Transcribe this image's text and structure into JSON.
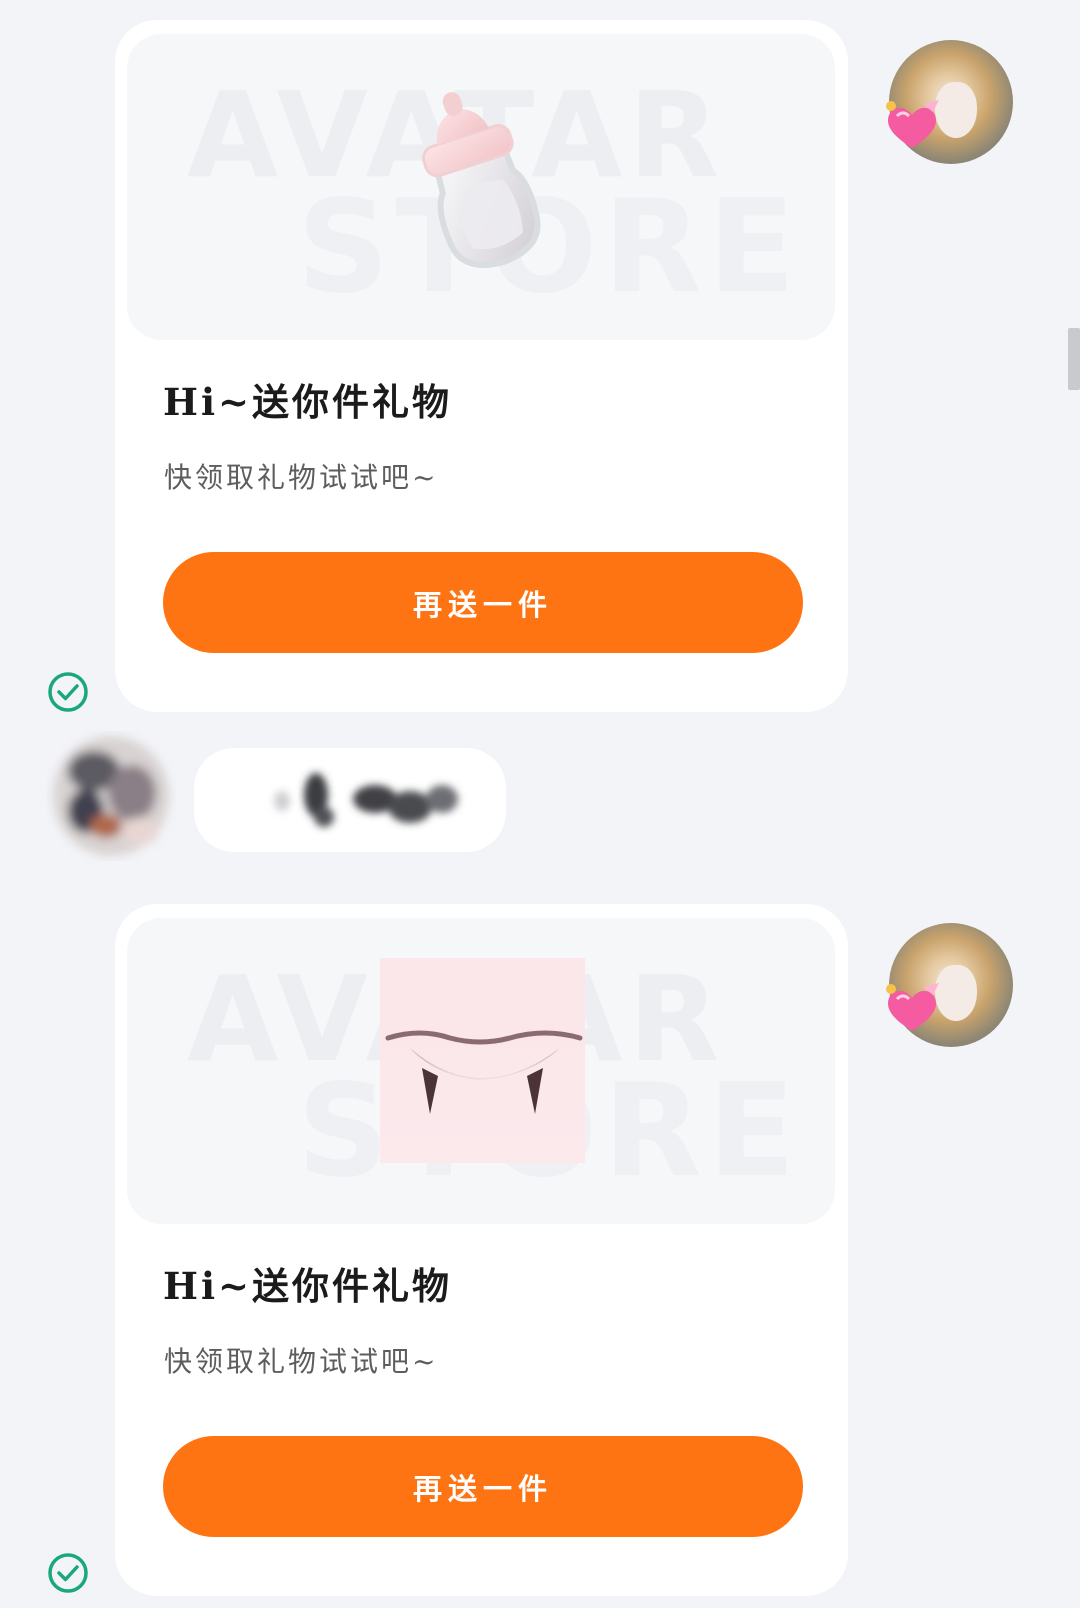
{
  "messages": [
    {
      "card": {
        "watermark_line1": "AVATAR",
        "watermark_line2": "STORE",
        "item_icon": "baby-bottle-icon",
        "title": "Hi~送你件礼物",
        "subtitle": "快领取礼物试试吧~",
        "button_label": "再送一件"
      },
      "sender": "self",
      "status": "sent"
    },
    {
      "sender": "other",
      "text_obscured": true
    },
    {
      "card": {
        "watermark_line1": "AVATAR",
        "watermark_line2": "STORE",
        "item_icon": "vampire-fangs-mouth-icon",
        "title": "Hi~送你件礼物",
        "subtitle": "快领取礼物试试吧~",
        "button_label": "再送一件"
      },
      "sender": "self",
      "status": "sent"
    }
  ],
  "colors": {
    "background": "#f3f4f8",
    "card": "#ffffff",
    "button": "#ff7412",
    "button_text": "#ffffff",
    "status_check": "#1aa87a"
  }
}
